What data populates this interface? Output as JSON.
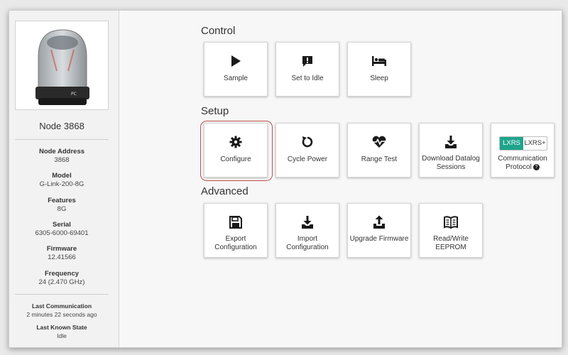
{
  "sidebar": {
    "node_title": "Node 3868",
    "fields": [
      {
        "label": "Node Address",
        "value": "3868"
      },
      {
        "label": "Model",
        "value": "G-Link-200-8G"
      },
      {
        "label": "Features",
        "value": "8G"
      },
      {
        "label": "Serial",
        "value": "6305-6000-69401"
      },
      {
        "label": "Firmware",
        "value": "12.41566"
      },
      {
        "label": "Frequency",
        "value": "24 (2.470 GHz)"
      }
    ],
    "status": [
      {
        "label": "Last Communication",
        "value": "2 minutes 22 seconds ago"
      },
      {
        "label": "Last Known State",
        "value": "Idle"
      }
    ]
  },
  "sections": {
    "control": {
      "title": "Control",
      "buttons": [
        {
          "label": "Sample",
          "icon": "play-icon"
        },
        {
          "label": "Set to Idle",
          "icon": "alert-icon"
        },
        {
          "label": "Sleep",
          "icon": "bed-icon"
        }
      ]
    },
    "setup": {
      "title": "Setup",
      "buttons": [
        {
          "label": "Configure",
          "icon": "gear-icon"
        },
        {
          "label": "Cycle Power",
          "icon": "refresh-icon"
        },
        {
          "label": "Range Test",
          "icon": "heartbeat-icon"
        },
        {
          "label": "Download Datalog Sessions",
          "icon": "download-icon"
        },
        {
          "label": "Communication Protocol",
          "icon": "help-icon"
        }
      ],
      "protocol_options": [
        "LXRS",
        "LXRS+"
      ],
      "protocol_selected": "LXRS"
    },
    "advanced": {
      "title": "Advanced",
      "buttons": [
        {
          "label": "Export Configuration",
          "icon": "save-icon"
        },
        {
          "label": "Import Configuration",
          "icon": "download-icon"
        },
        {
          "label": "Upgrade Firmware",
          "icon": "upload-icon"
        },
        {
          "label": "Read/Write EEPROM",
          "icon": "book-icon"
        }
      ]
    }
  },
  "colors": {
    "accent": "#1fa58c",
    "highlight": "#c0504d"
  }
}
